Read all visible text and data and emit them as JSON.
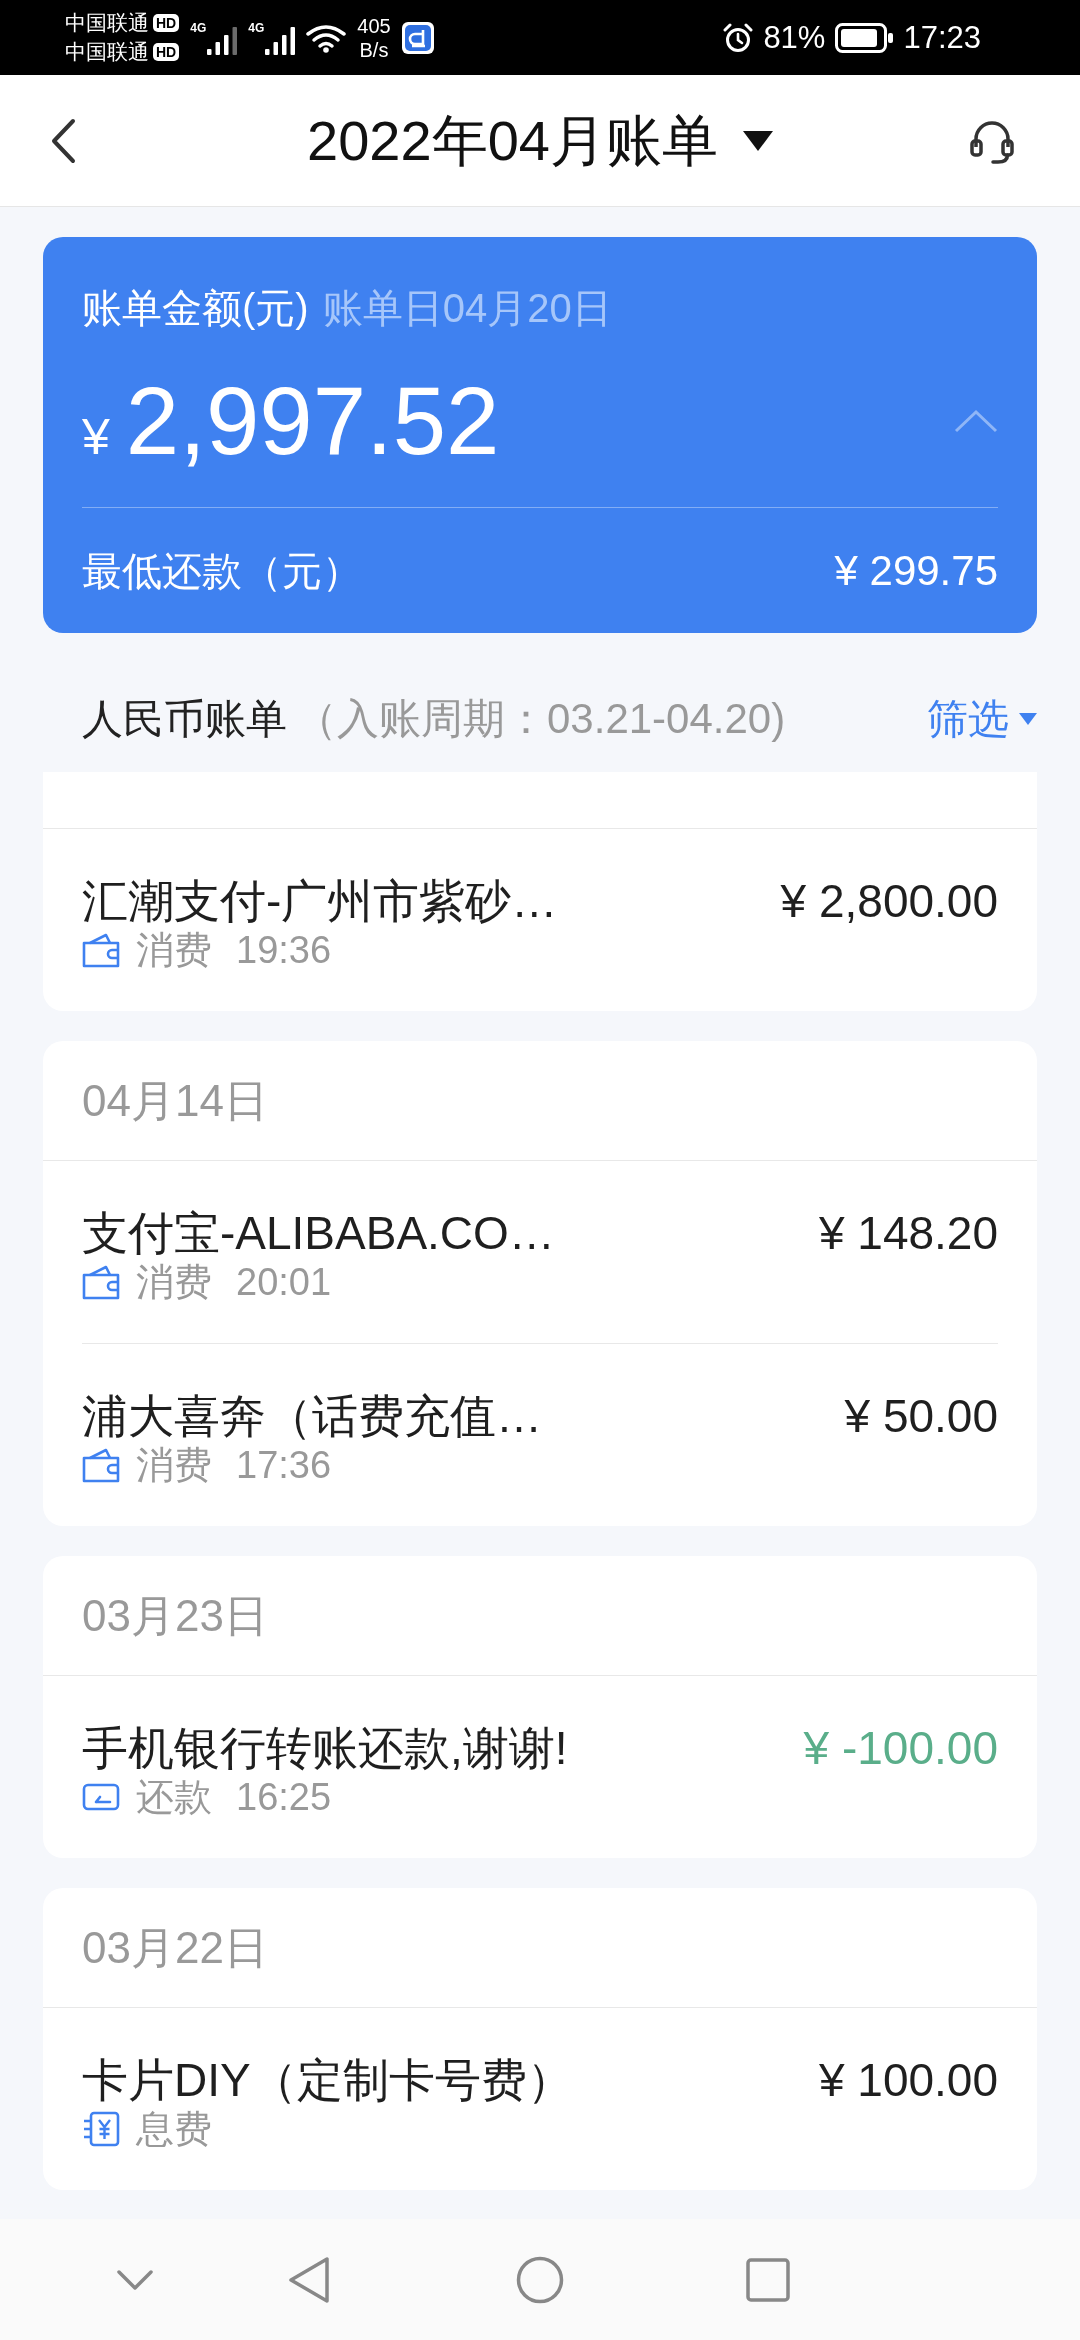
{
  "status_bar": {
    "carriers": [
      {
        "name": "中国联通",
        "badge": "HD"
      },
      {
        "name": "中国联通",
        "badge": "HD"
      }
    ],
    "signals": [
      {
        "network": "4G"
      },
      {
        "network": "4G"
      }
    ],
    "speed": {
      "value": "405",
      "unit": "B/s"
    },
    "battery": "81%",
    "time": "17:23"
  },
  "header": {
    "title": "2022年04月账单"
  },
  "bill_card": {
    "label": "账单金额(元)",
    "bill_date": "账单日04月20日",
    "currency": "¥",
    "amount": "2,997.52",
    "min_payment_label": "最低还款（元）",
    "min_payment": "¥ 299.75"
  },
  "section": {
    "title": "人民币账单",
    "period": "（入账周期：03.21-04.20)",
    "filter": "筛选"
  },
  "groups": [
    {
      "transactions": [
        {
          "kind": "purchase",
          "title": "汇潮支付-广州市紫砂…",
          "category": "消费",
          "time": "19:36",
          "amount": "¥ 2,800.00"
        }
      ]
    },
    {
      "date": "04月14日",
      "transactions": [
        {
          "kind": "purchase",
          "title": "支付宝-ALIBABA.CO…",
          "category": "消费",
          "time": "20:01",
          "amount": "¥ 148.20"
        },
        {
          "kind": "purchase",
          "title": "浦大喜奔（话费充值…",
          "category": "消费",
          "time": "17:36",
          "amount": "¥ 50.00"
        }
      ]
    },
    {
      "date": "03月23日",
      "transactions": [
        {
          "kind": "repayment",
          "title": "手机银行转账还款,谢谢!",
          "category": "还款",
          "time": "16:25",
          "amount": "¥ -100.00"
        }
      ]
    },
    {
      "date": "03月22日",
      "transactions": [
        {
          "kind": "fee",
          "title": "卡片DIY（定制卡号费）",
          "category": "息费",
          "amount": "¥ 100.00"
        }
      ]
    }
  ]
}
